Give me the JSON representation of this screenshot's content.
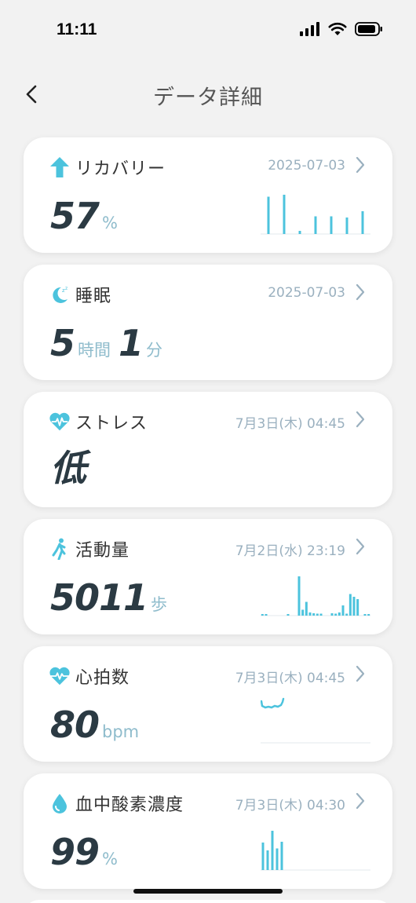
{
  "status": {
    "time": "11:11"
  },
  "nav": {
    "title": "データ詳細"
  },
  "colors": {
    "accent": "#4cc3dd",
    "text_dark": "#2b3a43",
    "muted": "#9ab0bf"
  },
  "cards": [
    {
      "title": "リカバリー",
      "icon": "arrow-up-icon",
      "date": "2025-07-03",
      "value": "57",
      "unit": "%",
      "bars": [
        0.95,
        1.0,
        0.08,
        0.45,
        0.45,
        0.42,
        0.58
      ]
    },
    {
      "title": "睡眠",
      "icon": "moon-icon",
      "date": "2025-07-03",
      "hours": "5",
      "hours_unit": "時間",
      "minutes": "1",
      "minutes_unit": "分"
    },
    {
      "title": "ストレス",
      "icon": "heart-pulse-icon",
      "date": "7月3日(木) 04:45",
      "value": "低"
    },
    {
      "title": "活動量",
      "icon": "walking-icon",
      "date": "7月2日(水) 23:19",
      "value": "5011",
      "unit": "歩",
      "bars": [
        0.02,
        0.03,
        0,
        0,
        0,
        0,
        0,
        0.04,
        0,
        0,
        1.0,
        0.15,
        0.35,
        0.08,
        0.06,
        0.05,
        0.05,
        0,
        0,
        0.06,
        0.05,
        0.08,
        0.26,
        0.05,
        0.55,
        0.48,
        0.42,
        0,
        0.04,
        0.04
      ]
    },
    {
      "title": "心拍数",
      "icon": "heart-rate-icon",
      "date": "7月3日(木) 04:45",
      "value": "80",
      "unit": "bpm"
    },
    {
      "title": "血中酸素濃度",
      "icon": "drop-icon",
      "date": "7月3日(木) 04:30",
      "value": "99",
      "unit": "%",
      "bars": [
        0.7,
        0.5,
        1.0,
        0.55,
        0.72
      ]
    }
  ]
}
